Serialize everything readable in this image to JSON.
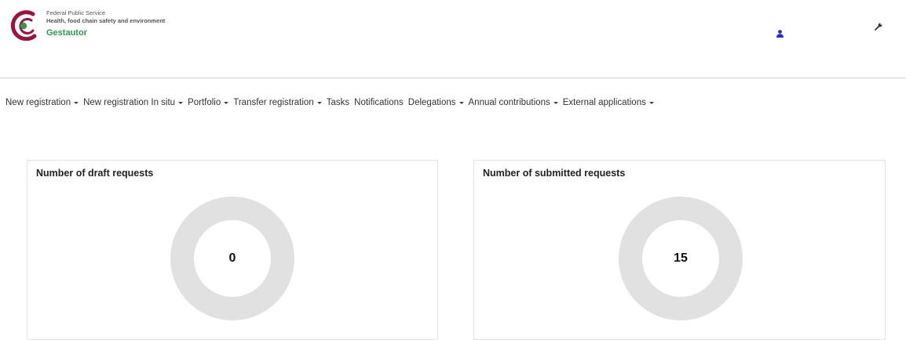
{
  "header": {
    "org_line1": "Federal Public Service",
    "org_line2": "Health, food chain safety and environment",
    "app_name": "Gestautor",
    "logo_colors": {
      "arc": "#a0123e",
      "dot": "#2e9a4f"
    },
    "user_icon": "user-icon",
    "user_icon_color": "#1a2ecc",
    "settings_icon": "wrench-icon"
  },
  "nav": {
    "items": [
      {
        "label": "New registration",
        "dropdown": true
      },
      {
        "label": "New registration In situ",
        "dropdown": true
      },
      {
        "label": "Portfolio",
        "dropdown": true
      },
      {
        "label": "Transfer registration",
        "dropdown": true
      },
      {
        "label": "Tasks",
        "dropdown": false
      },
      {
        "label": "Notifications",
        "dropdown": false
      },
      {
        "label": "Delegations",
        "dropdown": true
      },
      {
        "label": "Annual contributions",
        "dropdown": true
      },
      {
        "label": "External applications",
        "dropdown": true
      }
    ]
  },
  "panels": {
    "draft": {
      "title": "Number of draft requests",
      "count": "0"
    },
    "submitted": {
      "title": "Number of submitted requests",
      "count": "15"
    }
  },
  "colors": {
    "donut_ring": "#e1e1e1",
    "divider": "#cfcfcf"
  }
}
